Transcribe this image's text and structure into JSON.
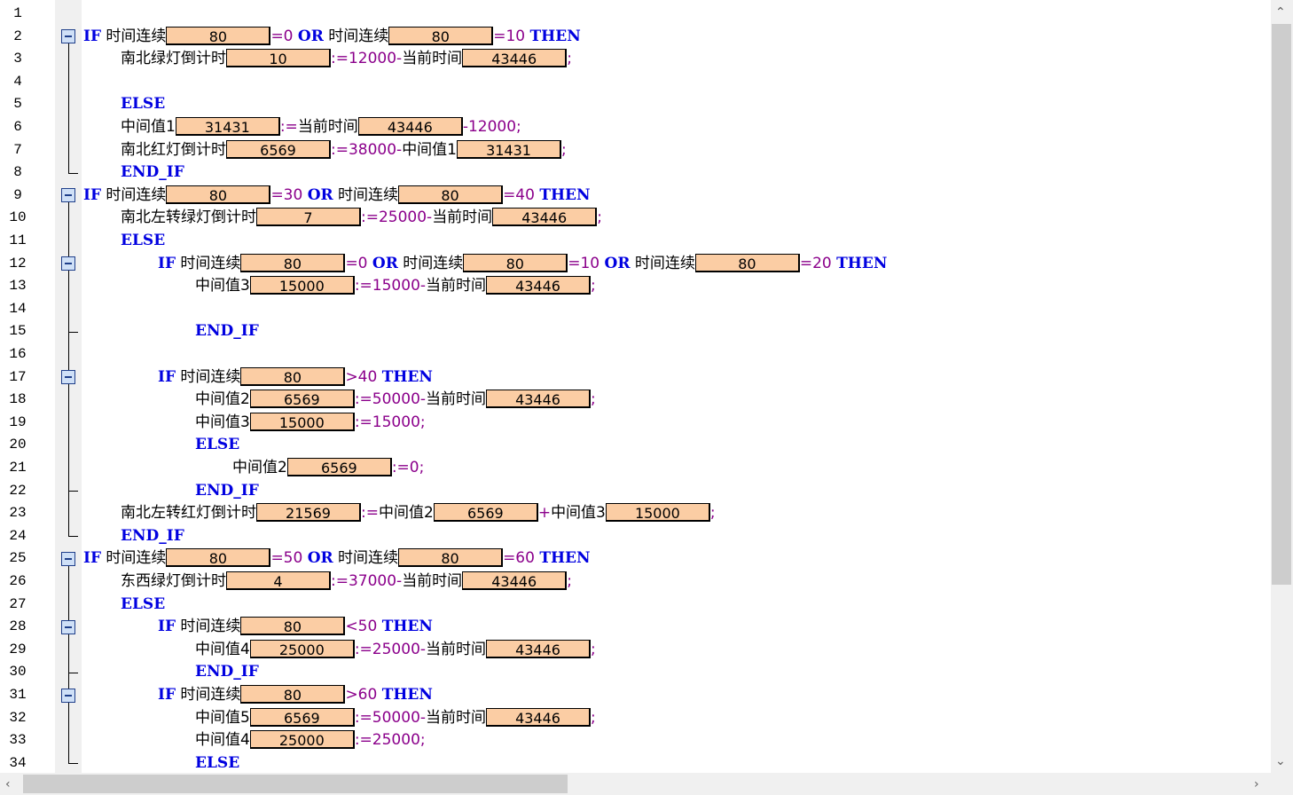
{
  "line_numbers": [
    "1",
    "2",
    "3",
    "4",
    "5",
    "6",
    "7",
    "8",
    "9",
    "10",
    "11",
    "12",
    "13",
    "14",
    "15",
    "16",
    "17",
    "18",
    "19",
    "20",
    "21",
    "22",
    "23",
    "24",
    "25",
    "26",
    "27",
    "28",
    "29",
    "30",
    "31",
    "32",
    "33",
    "34"
  ],
  "lines": [
    {
      "n": 2,
      "indent": 0,
      "t": [
        [
          "k",
          "IF"
        ],
        [
          "x",
          " 时间连续"
        ],
        [
          "v",
          "80"
        ],
        [
          "o",
          "=0 "
        ],
        [
          "k",
          "OR"
        ],
        [
          "x",
          " 时间连续"
        ],
        [
          "v",
          "80"
        ],
        [
          "o",
          "=10 "
        ],
        [
          "k",
          "THEN"
        ]
      ]
    },
    {
      "n": 3,
      "indent": 1,
      "t": [
        [
          "x",
          "南北绿灯倒计时"
        ],
        [
          "v",
          "10"
        ],
        [
          "o",
          ":=12000-"
        ],
        [
          "x",
          "当前时间"
        ],
        [
          "v",
          "43446"
        ],
        [
          "o",
          ";"
        ]
      ]
    },
    {
      "n": 5,
      "indent": 1,
      "t": [
        [
          "k",
          "ELSE"
        ]
      ]
    },
    {
      "n": 6,
      "indent": 1,
      "t": [
        [
          "x",
          "中间值1"
        ],
        [
          "v",
          "31431"
        ],
        [
          "o",
          ":="
        ],
        [
          "x",
          "当前时间"
        ],
        [
          "v",
          "43446"
        ],
        [
          "o",
          "-12000;"
        ]
      ]
    },
    {
      "n": 7,
      "indent": 1,
      "t": [
        [
          "x",
          "南北红灯倒计时"
        ],
        [
          "v",
          "6569"
        ],
        [
          "o",
          ":=38000-"
        ],
        [
          "x",
          "中间值1"
        ],
        [
          "v",
          "31431"
        ],
        [
          "o",
          ";"
        ]
      ]
    },
    {
      "n": 8,
      "indent": 1,
      "t": [
        [
          "k",
          "END_IF"
        ]
      ]
    },
    {
      "n": 9,
      "indent": 0,
      "t": [
        [
          "k",
          "IF"
        ],
        [
          "x",
          " 时间连续"
        ],
        [
          "v",
          "80"
        ],
        [
          "o",
          "=30 "
        ],
        [
          "k",
          "OR"
        ],
        [
          "x",
          " 时间连续"
        ],
        [
          "v",
          "80"
        ],
        [
          "o",
          "=40 "
        ],
        [
          "k",
          "THEN"
        ]
      ]
    },
    {
      "n": 10,
      "indent": 1,
      "t": [
        [
          "x",
          "南北左转绿灯倒计时"
        ],
        [
          "v",
          "7"
        ],
        [
          "o",
          ":=25000-"
        ],
        [
          "x",
          "当前时间"
        ],
        [
          "v",
          "43446"
        ],
        [
          "o",
          ";"
        ]
      ]
    },
    {
      "n": 11,
      "indent": 1,
      "t": [
        [
          "k",
          "ELSE"
        ]
      ]
    },
    {
      "n": 12,
      "indent": 2,
      "t": [
        [
          "k",
          "IF"
        ],
        [
          "x",
          " 时间连续"
        ],
        [
          "v",
          "80"
        ],
        [
          "o",
          "=0 "
        ],
        [
          "k",
          "OR"
        ],
        [
          "x",
          " 时间连续"
        ],
        [
          "v",
          "80"
        ],
        [
          "o",
          "=10 "
        ],
        [
          "k",
          "OR"
        ],
        [
          "x",
          " 时间连续"
        ],
        [
          "v",
          "80"
        ],
        [
          "o",
          "=20 "
        ],
        [
          "k",
          "THEN"
        ]
      ]
    },
    {
      "n": 13,
      "indent": 3,
      "t": [
        [
          "x",
          "中间值3"
        ],
        [
          "v",
          "15000"
        ],
        [
          "o",
          ":=15000-"
        ],
        [
          "x",
          "当前时间"
        ],
        [
          "v",
          "43446"
        ],
        [
          "o",
          ";"
        ]
      ]
    },
    {
      "n": 15,
      "indent": 3,
      "t": [
        [
          "k",
          "END_IF"
        ]
      ]
    },
    {
      "n": 17,
      "indent": 2,
      "t": [
        [
          "k",
          "IF"
        ],
        [
          "x",
          " 时间连续"
        ],
        [
          "v",
          "80"
        ],
        [
          "o",
          ">40 "
        ],
        [
          "k",
          "THEN"
        ]
      ]
    },
    {
      "n": 18,
      "indent": 3,
      "t": [
        [
          "x",
          "中间值2"
        ],
        [
          "v",
          "6569"
        ],
        [
          "o",
          ":=50000-"
        ],
        [
          "x",
          "当前时间"
        ],
        [
          "v",
          "43446"
        ],
        [
          "o",
          ";"
        ]
      ]
    },
    {
      "n": 19,
      "indent": 3,
      "t": [
        [
          "x",
          "中间值3"
        ],
        [
          "v",
          "15000"
        ],
        [
          "o",
          ":=15000;"
        ]
      ]
    },
    {
      "n": 20,
      "indent": 3,
      "t": [
        [
          "k",
          "ELSE"
        ]
      ]
    },
    {
      "n": 21,
      "indent": 4,
      "t": [
        [
          "x",
          "中间值2"
        ],
        [
          "v",
          "6569"
        ],
        [
          "o",
          ":=0;"
        ]
      ]
    },
    {
      "n": 22,
      "indent": 3,
      "t": [
        [
          "k",
          "END_IF"
        ]
      ]
    },
    {
      "n": 23,
      "indent": 1,
      "t": [
        [
          "x",
          "南北左转红灯倒计时"
        ],
        [
          "v",
          "21569"
        ],
        [
          "o",
          ":="
        ],
        [
          "x",
          "中间值2"
        ],
        [
          "v",
          "6569"
        ],
        [
          "o",
          "+"
        ],
        [
          "x",
          "中间值3"
        ],
        [
          "v",
          "15000"
        ],
        [
          "o",
          ";"
        ]
      ]
    },
    {
      "n": 24,
      "indent": 1,
      "t": [
        [
          "k",
          "END_IF"
        ]
      ]
    },
    {
      "n": 25,
      "indent": 0,
      "t": [
        [
          "k",
          "IF"
        ],
        [
          "x",
          " 时间连续"
        ],
        [
          "v",
          "80"
        ],
        [
          "o",
          "=50 "
        ],
        [
          "k",
          "OR"
        ],
        [
          "x",
          " 时间连续"
        ],
        [
          "v",
          "80"
        ],
        [
          "o",
          "=60 "
        ],
        [
          "k",
          "THEN"
        ]
      ]
    },
    {
      "n": 26,
      "indent": 1,
      "t": [
        [
          "x",
          "东西绿灯倒计时"
        ],
        [
          "v",
          "4"
        ],
        [
          "o",
          ":=37000-"
        ],
        [
          "x",
          "当前时间"
        ],
        [
          "v",
          "43446"
        ],
        [
          "o",
          ";"
        ]
      ]
    },
    {
      "n": 27,
      "indent": 1,
      "t": [
        [
          "k",
          "ELSE"
        ]
      ]
    },
    {
      "n": 28,
      "indent": 2,
      "t": [
        [
          "k",
          "IF"
        ],
        [
          "x",
          " 时间连续"
        ],
        [
          "v",
          "80"
        ],
        [
          "o",
          "<50 "
        ],
        [
          "k",
          "THEN"
        ]
      ]
    },
    {
      "n": 29,
      "indent": 3,
      "t": [
        [
          "x",
          "中间值4"
        ],
        [
          "v",
          "25000"
        ],
        [
          "o",
          ":=25000-"
        ],
        [
          "x",
          "当前时间"
        ],
        [
          "v",
          "43446"
        ],
        [
          "o",
          ";"
        ]
      ]
    },
    {
      "n": 30,
      "indent": 3,
      "t": [
        [
          "k",
          "END_IF"
        ]
      ]
    },
    {
      "n": 31,
      "indent": 2,
      "t": [
        [
          "k",
          "IF"
        ],
        [
          "x",
          " 时间连续"
        ],
        [
          "v",
          "80"
        ],
        [
          "o",
          ">60 "
        ],
        [
          "k",
          "THEN"
        ]
      ]
    },
    {
      "n": 32,
      "indent": 3,
      "t": [
        [
          "x",
          "中间值5"
        ],
        [
          "v",
          "6569"
        ],
        [
          "o",
          ":=50000-"
        ],
        [
          "x",
          "当前时间"
        ],
        [
          "v",
          "43446"
        ],
        [
          "o",
          ";"
        ]
      ]
    },
    {
      "n": 33,
      "indent": 3,
      "t": [
        [
          "x",
          "中间值4"
        ],
        [
          "v",
          "25000"
        ],
        [
          "o",
          ":=25000;"
        ]
      ]
    },
    {
      "n": 34,
      "indent": 3,
      "t": [
        [
          "k",
          "ELSE"
        ]
      ]
    }
  ],
  "folds": [
    {
      "start": 2,
      "end": 8
    },
    {
      "start": 9,
      "end": 24
    },
    {
      "start": 12,
      "end": 15
    },
    {
      "start": 17,
      "end": 22
    },
    {
      "start": 25,
      "end": 34
    },
    {
      "start": 28,
      "end": 30
    },
    {
      "start": 31,
      "end": 34
    }
  ],
  "colors": {
    "keyword": "#0000e0",
    "operator": "#8b008b",
    "value_box": "#fbcda4",
    "fold_box": "#cfe0f7"
  },
  "icons": {
    "up": "chevron-up-icon",
    "down": "chevron-down-icon",
    "left": "chevron-left-icon",
    "right": "chevron-right-icon"
  }
}
